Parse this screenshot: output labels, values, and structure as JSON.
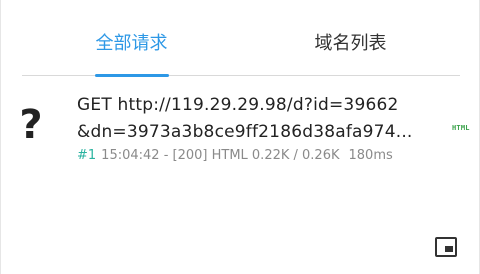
{
  "tabs": [
    {
      "label": "全部请求",
      "active": true
    },
    {
      "label": "域名列表",
      "active": false
    }
  ],
  "request": {
    "icon": "question-mark-icon",
    "icon_glyph": "?",
    "url_line1": "GET http://119.29.29.98/d?id=39662",
    "url_line2": "&dn=3973a3b8ce9ff2186d38afa974...",
    "index": "#1",
    "status": "15:04:42 - [200] HTML 0.22K / 0.26K",
    "duration": "180ms",
    "type_badge": "HTML"
  },
  "colors": {
    "accent": "#2d98e6",
    "index": "#2ab3a0",
    "badge": "#3aa24a"
  },
  "pip_button": {
    "icon": "picture-in-picture-icon"
  }
}
